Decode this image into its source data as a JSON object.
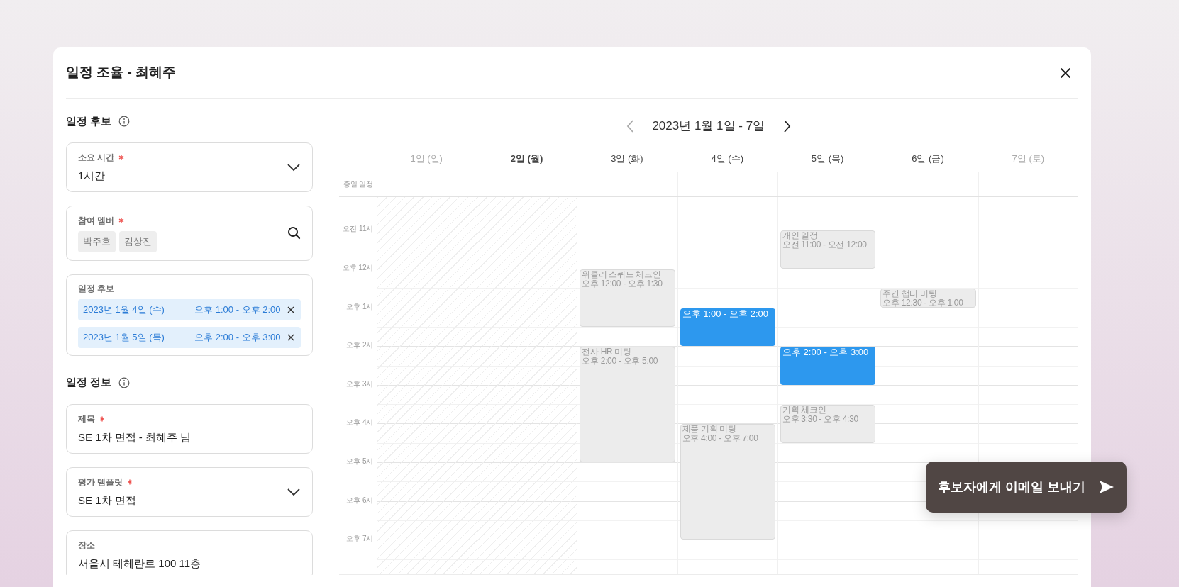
{
  "dialog": {
    "title": "일정 조율 - 최혜주"
  },
  "sections": [
    {
      "title": "일정 후보",
      "fields": [
        {
          "kind": "select",
          "label": "소요 시간",
          "required": true,
          "value": "1시간"
        },
        {
          "kind": "members",
          "label": "참여 멤버",
          "required": true,
          "members": [
            "박주호",
            "김상진"
          ]
        },
        {
          "kind": "candidates",
          "label": "일정 후보",
          "required": false,
          "candidates": [
            {
              "date": "2023년 1월 4일 (수)",
              "time": "오후 1:00 - 오후 2:00"
            },
            {
              "date": "2023년 1월 5일 (목)",
              "time": "오후 2:00 - 오후 3:00"
            }
          ]
        }
      ]
    },
    {
      "title": "일정 정보",
      "fields": [
        {
          "kind": "text",
          "label": "제목",
          "required": true,
          "value": "SE 1차 면접 - 최혜주 님"
        },
        {
          "kind": "select",
          "label": "평가 템플릿",
          "required": true,
          "value": "SE 1차 면접"
        },
        {
          "kind": "text",
          "label": "장소",
          "required": false,
          "value": "서울시 테헤란로 100 11층"
        }
      ]
    }
  ],
  "calendar": {
    "range": "2023년 1월 1일 - 7일",
    "prev_disabled": true,
    "next_disabled": false,
    "all_day_label": "종일 일정",
    "hours": [
      "오전 11시",
      "오후 12시",
      "오후 1시",
      "오후 2시",
      "오후 3시",
      "오후 4시",
      "오후 5시",
      "오후 6시",
      "오후 7시"
    ],
    "days": [
      {
        "label": "1일 (일)",
        "weekend": true,
        "today": false,
        "unavailable": true
      },
      {
        "label": "2일 (월)",
        "weekend": false,
        "today": true,
        "unavailable": true
      },
      {
        "label": "3일 (화)",
        "weekend": false,
        "today": false,
        "unavailable": false,
        "events": [
          {
            "kind": "busy",
            "title": "위클리 스쿼드 체크인",
            "time": "오후 12:00 - 오후 1:30"
          },
          {
            "kind": "busy",
            "title": "전사 HR 미팅",
            "time": "오후 2:00 - 오후 5:00"
          }
        ]
      },
      {
        "label": "4일 (수)",
        "weekend": false,
        "today": false,
        "unavailable": false,
        "events": [
          {
            "kind": "candidate",
            "time": "오후 1:00 - 오후 2:00"
          },
          {
            "kind": "busy",
            "title": "제품 기획 미팅",
            "time": "오후 4:00 - 오후 7:00"
          }
        ]
      },
      {
        "label": "5일 (목)",
        "weekend": false,
        "today": false,
        "unavailable": false,
        "events": [
          {
            "kind": "busy",
            "title": "개인 일정",
            "time": "오전 11:00 - 오전 12:00"
          },
          {
            "kind": "candidate",
            "time": "오후 2:00 - 오후 3:00"
          },
          {
            "kind": "busy",
            "title": "기획 체크인",
            "time": "오후 3:30 - 오후 4:30"
          }
        ]
      },
      {
        "label": "6일 (금)",
        "weekend": false,
        "today": false,
        "unavailable": false,
        "events": [
          {
            "kind": "busy",
            "title": "주간 챕터 미팅",
            "time": "오후 12:30 - 오후 1:00"
          }
        ]
      },
      {
        "label": "7일 (토)",
        "weekend": true,
        "today": false,
        "unavailable": false
      }
    ]
  },
  "send_button": {
    "label": "후보자에게 이메일 보내기"
  }
}
